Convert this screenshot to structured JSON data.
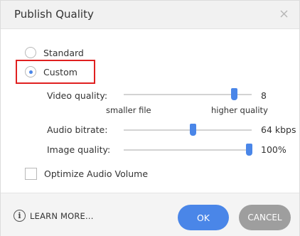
{
  "dialog": {
    "title": "Publish Quality",
    "close_icon": "close-icon"
  },
  "quality": {
    "options": [
      {
        "label": "Standard",
        "checked": false
      },
      {
        "label": "Custom",
        "checked": true
      }
    ]
  },
  "sliders": {
    "video": {
      "label": "Video quality:",
      "value": "8",
      "level": 0.86,
      "min_hint": "smaller file",
      "max_hint": "higher quality"
    },
    "audio": {
      "label": "Audio bitrate:",
      "value": "64 kbps",
      "level": 0.54
    },
    "image": {
      "label": "Image quality:",
      "value": "100%",
      "level": 0.98
    }
  },
  "optimize_audio": {
    "label": "Optimize Audio Volume",
    "checked": false
  },
  "footer": {
    "info_icon": "info-icon",
    "learn_more": "LEARN MORE...",
    "ok_label": "OK",
    "cancel_label": "CANCEL"
  },
  "colors": {
    "accent": "#4a86e8",
    "highlight": "#e02020",
    "cancel": "#9e9e9e"
  }
}
